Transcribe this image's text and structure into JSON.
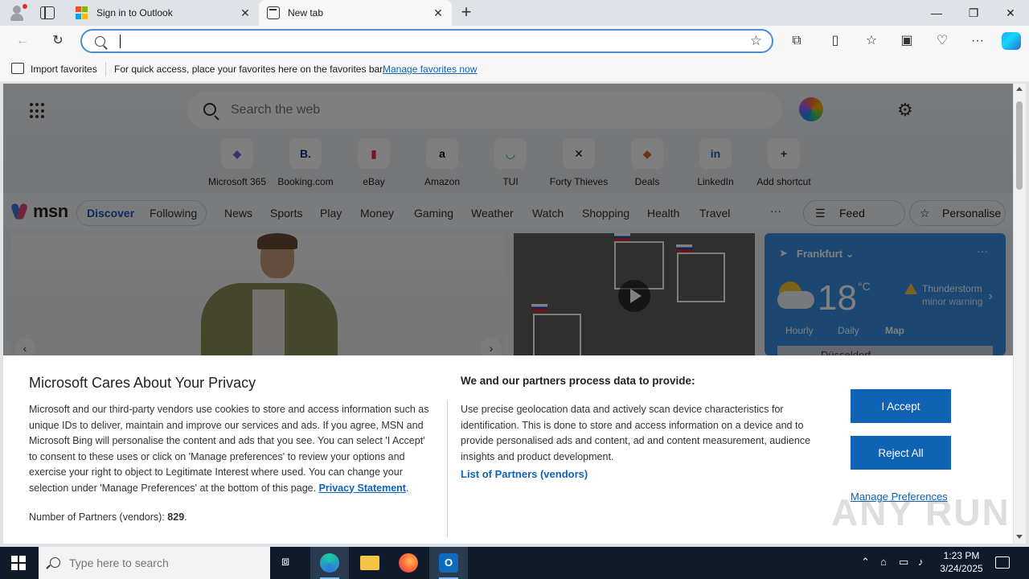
{
  "browser": {
    "tabs": [
      {
        "title": "Sign in to Outlook",
        "icon": "microsoft-logo-icon"
      },
      {
        "title": "New tab",
        "icon": "new-tab-page-icon"
      }
    ],
    "address_bar": {
      "value": "",
      "placeholder": ""
    },
    "favorites_bar": {
      "import_label": "Import favorites",
      "hint": "For quick access, place your favorites here on the favorites bar.",
      "manage_link": "Manage favorites now"
    }
  },
  "new_tab": {
    "search_placeholder": "Search the web",
    "shortcuts": [
      {
        "label": "Microsoft 365",
        "glyph": "◆",
        "color": "#7b61d6"
      },
      {
        "label": "Booking.com",
        "glyph": "B.",
        "color": "#003580"
      },
      {
        "label": "eBay",
        "glyph": "▮",
        "color": "#e53238"
      },
      {
        "label": "Amazon",
        "glyph": "a",
        "color": "#111111"
      },
      {
        "label": "TUI",
        "glyph": "◡",
        "color": "#1d9bd7"
      },
      {
        "label": "Forty Thieves",
        "glyph": "✕",
        "color": "#111111"
      },
      {
        "label": "Deals",
        "glyph": "◆",
        "color": "#d9692b"
      },
      {
        "label": "LinkedIn",
        "glyph": "in",
        "color": "#0a66c2"
      },
      {
        "label": "Add shortcut",
        "glyph": "+",
        "color": "#333333"
      }
    ],
    "msn": {
      "logo": "msn",
      "tabs": [
        "Discover",
        "Following"
      ],
      "nav": [
        "News",
        "Sports",
        "Play",
        "Money",
        "Gaming",
        "Weather",
        "Watch",
        "Shopping",
        "Health",
        "Travel"
      ],
      "more": "···",
      "feed_layout": "Feed layout",
      "personalise": "Personalise"
    },
    "weather": {
      "location": "Frankfurt",
      "temperature": "18",
      "unit": "°C",
      "warning_line1": "Thunderstorm",
      "warning_line2": "minor warning",
      "tabs": [
        "Hourly",
        "Daily",
        "Map"
      ],
      "active_tab": "Map",
      "map_label": "Düsseldorf"
    }
  },
  "privacy": {
    "title": "Microsoft Cares About Your Privacy",
    "body": "Microsoft and our third-party vendors use cookies to store and access information such as unique IDs to deliver, maintain and improve our services and ads. If you agree, MSN and Microsoft Bing will personalise the content and ads that you see. You can select 'I Accept' to consent to these uses or click on 'Manage preferences' to review your options and exercise your right to object to Legitimate Interest where used.  You can change your selection under 'Manage Preferences' at the bottom of this page.",
    "privacy_link": "Privacy Statement",
    "partners_count_label": "Number of Partners (vendors):",
    "partners_count": "829",
    "purposes_heading": "We and our partners process data to provide:",
    "purposes_body": "Use precise geolocation data and actively scan device characteristics for identification. This is done to store and access information on a device and to provide personalised ads and content, ad and content measurement, audience insights and product development.",
    "partners_link": "List of Partners (vendors)",
    "accept": "I Accept",
    "reject": "Reject All",
    "manage": "Manage Preferences",
    "watermark": "ANY RUN"
  },
  "taskbar": {
    "search_placeholder": "Type here to search",
    "time": "1:23 PM",
    "date": "3/24/2025"
  }
}
